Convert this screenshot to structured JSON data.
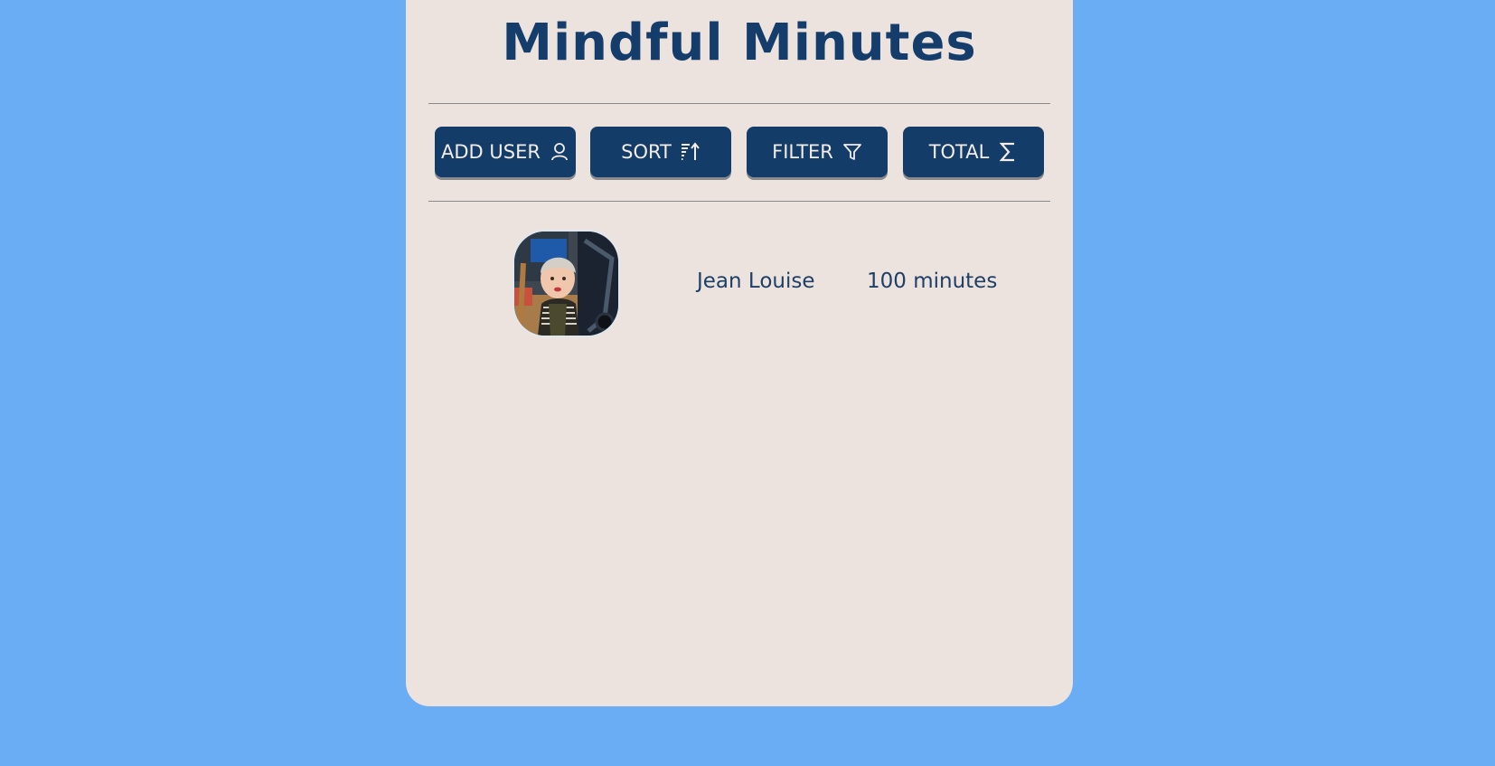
{
  "app": {
    "title": "Mindful Minutes"
  },
  "toolbar": {
    "add_user_label": "ADD USER",
    "sort_label": "SORT",
    "filter_label": "FILTER",
    "total_label": "TOTAL"
  },
  "icons": {
    "add_user": "user-icon",
    "sort": "sort-ascending-icon",
    "filter": "filter-funnel-icon",
    "total": "sigma-icon"
  },
  "users": [
    {
      "name": "Jean Louise",
      "minutes": "100 minutes"
    }
  ],
  "colors": {
    "background": "#6aadf5",
    "card": "#ede3de",
    "primary": "#133d68",
    "button_text": "#f3ece8",
    "text": "#1e3f66"
  }
}
